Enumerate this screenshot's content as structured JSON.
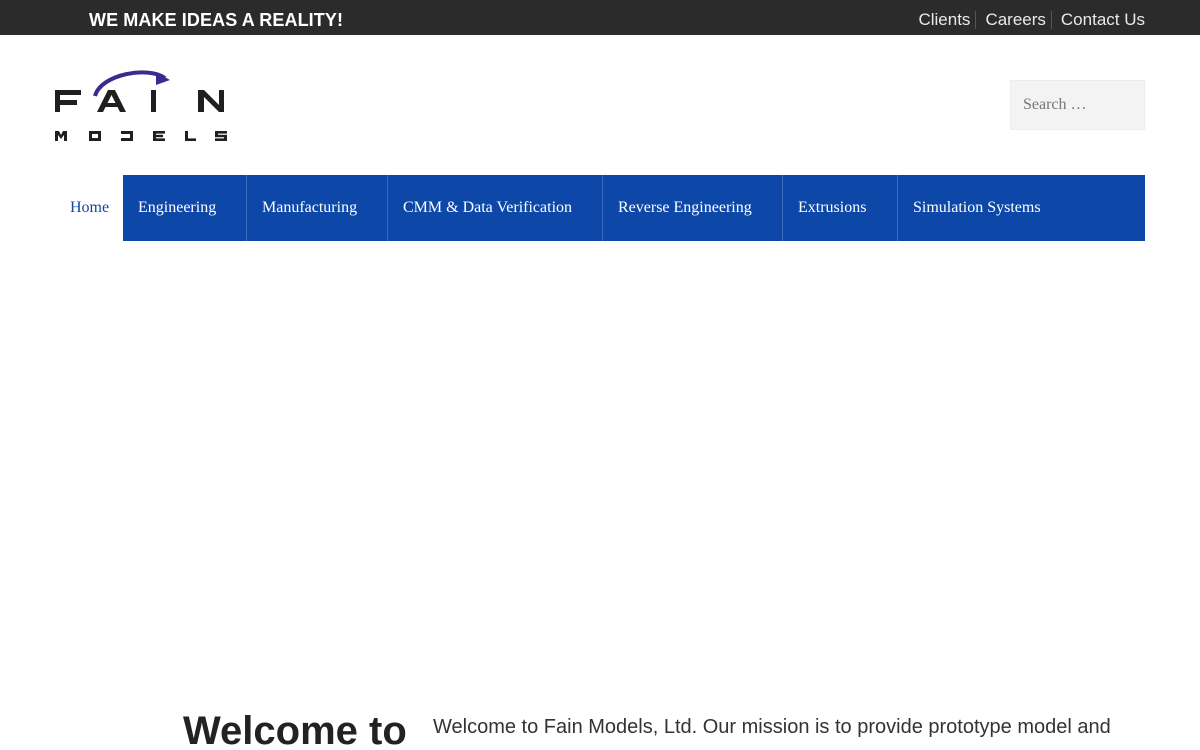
{
  "topbar": {
    "tagline": "WE MAKE IDEAS A REALITY!",
    "links": [
      "Clients",
      "Careers",
      "Contact Us"
    ]
  },
  "logo": {
    "word_top": "FAIN",
    "word_bottom": "MODELS",
    "swoosh_color": "#3d2a8f"
  },
  "search": {
    "placeholder": "Search …"
  },
  "nav": {
    "items": [
      "Home",
      "Engineering",
      "Manufacturing",
      "CMM & Data Verification",
      "Reverse Engineering",
      "Extrusions",
      "Simulation Systems"
    ],
    "active": "Home"
  },
  "welcome": {
    "title": "Welcome to",
    "text": "Welcome to Fain Models, Ltd. Our mission is to provide prototype model and"
  },
  "colors": {
    "topbar_bg": "#2b2b2b",
    "nav_bg": "#0d47a8",
    "accent": "#0d47a8"
  }
}
